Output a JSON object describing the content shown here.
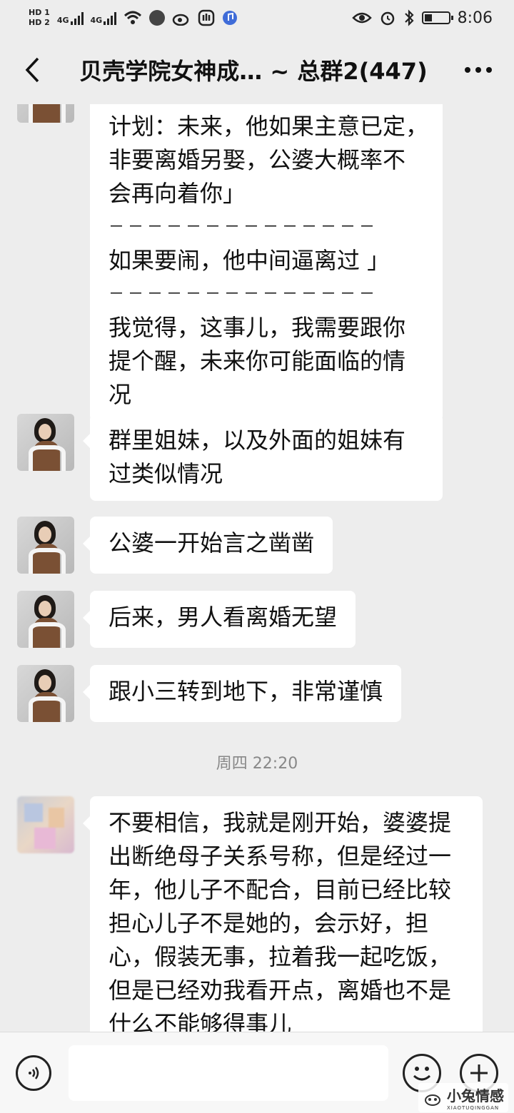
{
  "status_bar": {
    "hd1": "HD 1",
    "hd2": "HD 2",
    "net1": "4G",
    "net2": "4G",
    "time": "8:06"
  },
  "header": {
    "title": "贝壳学院女神成… ~ 总群2(447)",
    "back_icon": "chevron-left-icon",
    "more_icon": "more-dots-icon"
  },
  "messages": [
    {
      "lines": [
        "计划：未来，他如果主意已定，",
        "非要离婚另娶，公婆大概率不",
        "会再向着你」",
        "－－－－－－－－－－－－－－",
        "如果要闹，他中间逼离过 」",
        "－－－－－－－－－－－－－－",
        "我觉得，这事儿，我需要跟你",
        "提个醒，未来你可能面临的情",
        "况"
      ]
    },
    {
      "lines": [
        "群里姐妹，以及外面的姐妹有",
        "过类似情况"
      ]
    },
    {
      "lines": [
        "公婆一开始言之凿凿"
      ]
    },
    {
      "lines": [
        "后来，男人看离婚无望"
      ]
    },
    {
      "lines": [
        "跟小三转到地下，非常谨慎"
      ]
    },
    {
      "lines": [
        "不要相信，我就是刚开始，婆婆提",
        "出断绝母子关系号称，但是经过一",
        "年，他儿子不配合，目前已经比较",
        "担心儿子不是她的，会示好，担",
        "心，假装无事，拉着我一起吃饭，",
        "但是已经劝我看开点，离婚也不是",
        "什么不能够得事儿"
      ]
    }
  ],
  "timestamp": "周四 22:20",
  "input_bar": {
    "voice_icon": "voice-icon",
    "emoji_icon": "emoji-icon",
    "plus_icon": "plus-icon",
    "input_value": ""
  },
  "watermark": {
    "text": "小兔情感",
    "sub": "XIAOTUQINGGAN"
  }
}
